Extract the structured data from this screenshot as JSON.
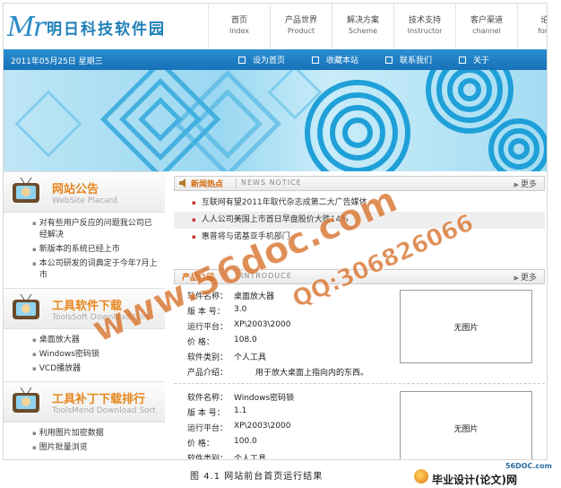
{
  "site": {
    "logo_mark": "Mr",
    "logo_text": "明日科技软件园"
  },
  "nav": [
    {
      "cn": "首页",
      "en": "Index"
    },
    {
      "cn": "产品世界",
      "en": "Product"
    },
    {
      "cn": "解决方案",
      "en": "Scheme"
    },
    {
      "cn": "技术支持",
      "en": "Instructor"
    },
    {
      "cn": "客户渠道",
      "en": "channel"
    },
    {
      "cn": "论坛",
      "en": "forum"
    }
  ],
  "topbar": {
    "date": "2011年05月25日  星期三",
    "links": [
      "设为首页",
      "收藏本站",
      "联系我们",
      "关于"
    ]
  },
  "sidebar": {
    "announce": {
      "title": "网站公告",
      "subtitle": "WebSite Placard",
      "items": [
        "对有些用户反应的问题我公司已经解决",
        "新版本的系统已经上市",
        "本公司研发的词典定于今年7月上市"
      ]
    },
    "tools": {
      "title": "工具软件下载",
      "subtitle": "ToolsSoft Download Sort",
      "items": [
        "桌面放大器",
        "Windows密码锁",
        "VCD播放器"
      ]
    },
    "patch": {
      "title": "工具补丁下载排行",
      "subtitle": "ToolsMend Download Sort",
      "items": [
        "利用图片加密数据",
        "图片批量浏览"
      ]
    }
  },
  "news": {
    "title": "新闻热点",
    "en": "NEWS NOTICE",
    "more": "更多",
    "items": [
      "互联网有望2011年取代杂志成第二大广告媒体",
      "人人公司美国上市首日早盘股价大跌14%",
      "惠普将与诺基亚手机部门"
    ]
  },
  "products": {
    "title": "产品介绍",
    "en": "INTRODUCE",
    "more": "更多",
    "labels": {
      "name": "软件名称：",
      "version": "版 本 号：",
      "platform": "运行平台：",
      "price": "价    格：",
      "category": "软件类别：",
      "intro": "产品介绍："
    },
    "no_image": "无图片",
    "items": [
      {
        "name": "桌面放大器",
        "version": "3.0",
        "platform": "XP\\2003\\2000",
        "price": "108.0",
        "category": "个人工具",
        "intro": "用于放大桌面上指向内的东西。"
      },
      {
        "name": "Windows密码锁",
        "version": "1.1",
        "platform": "XP\\2003\\2000",
        "price": "100.0",
        "category": "个人工具"
      }
    ]
  },
  "caption": "图 4.1  网站前台首页运行结果",
  "watermarks": {
    "site": "www.56doc.com",
    "qq": "QQ:306826066"
  },
  "corner": {
    "site": "56DOC.com",
    "text": "毕业设计(论文)网"
  }
}
